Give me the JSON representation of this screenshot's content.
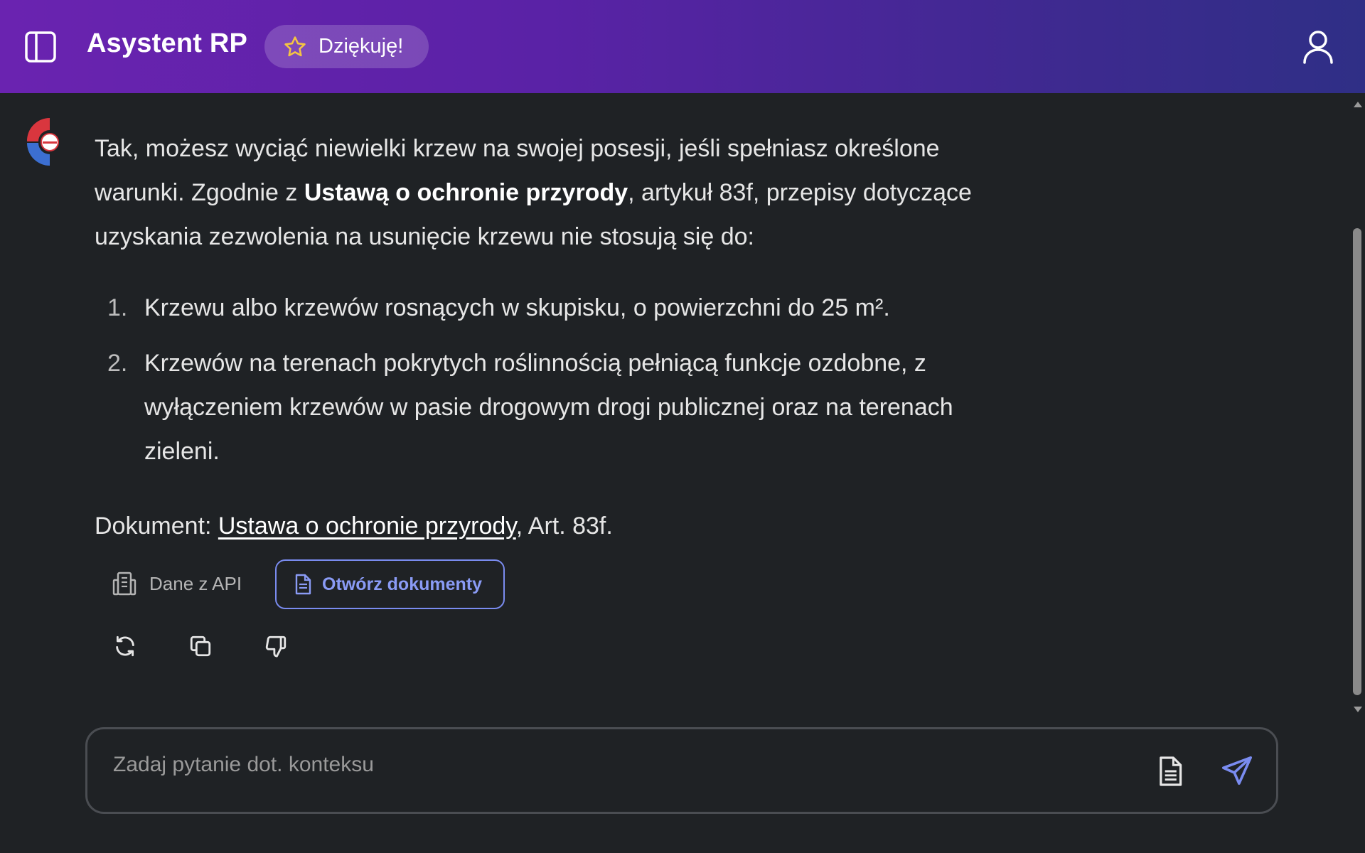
{
  "header": {
    "title": "Asystent RP",
    "thanks_label": "Dziękuję!",
    "gradient_start": "#6a23b0",
    "gradient_end": "#2f2f86"
  },
  "message": {
    "p1_a": "Tak, możesz wyciąć niewielki krzew na swojej posesji, jeśli spełniasz określone warunki. Zgodnie z ",
    "p1_bold": "Ustawą o ochronie przyrody",
    "p1_b": ", artykuł 83f, przepisy dotyczące uzyskania zezwolenia na usunięcie krzewu nie stosują się do:",
    "list": [
      {
        "num": "1.",
        "text": "Krzewu albo krzewów rosnących w skupisku, o powierzchni do 25 m²."
      },
      {
        "num": "2.",
        "text": "Krzewów na terenach pokrytych roślinnością pełniącą funkcje ozdobne, z wyłączeniem krzewów w pasie drogowym drogi publicznej oraz na terenach zieleni."
      }
    ],
    "doc_prefix": "Dokument: ",
    "doc_link": "Ustawa o ochronie przyrody",
    "doc_suffix": ", Art. 83f."
  },
  "source": {
    "api_label": "Dane z API",
    "open_docs_label": "Otwórz dokumenty",
    "accent": "#7a8cf0"
  },
  "actions": {
    "icons": [
      "refresh-icon",
      "copy-icon",
      "thumbs-down-icon"
    ]
  },
  "input": {
    "placeholder": "Zadaj pytanie dot. konteksu",
    "value": ""
  }
}
